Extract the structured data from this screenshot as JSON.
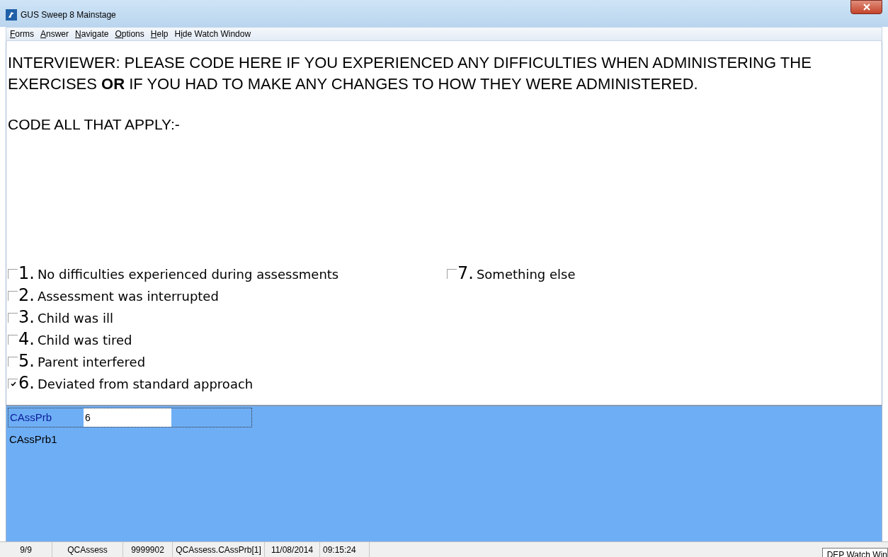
{
  "window": {
    "title": "GUS Sweep 8 Mainstage"
  },
  "menu": [
    {
      "key": "F",
      "rest": "orms"
    },
    {
      "key": "A",
      "rest": "nswer"
    },
    {
      "key": "N",
      "rest": "avigate"
    },
    {
      "key": "O",
      "rest": "ptions"
    },
    {
      "key": "H",
      "rest": "elp"
    },
    {
      "lead": "H",
      "key": "i",
      "rest": "de Watch Window"
    }
  ],
  "question": {
    "text": "INTERVIEWER: PLEASE CODE HERE IF YOU EXPERIENCED ANY DIFFICULTIES WHEN ADMINISTERING THE EXERCISES **OR** IF YOU HAD TO MAKE ANY CHANGES TO HOW THEY WERE ADMINISTERED.",
    "instruction": "CODE ALL THAT APPLY:-"
  },
  "options_left": [
    {
      "number": "1.",
      "label": "No difficulties experienced during assessments",
      "checked": false
    },
    {
      "number": "2.",
      "label": "Assessment was interrupted",
      "checked": false
    },
    {
      "number": "3.",
      "label": "Child was ill",
      "checked": false
    },
    {
      "number": "4.",
      "label": "Child was tired",
      "checked": false
    },
    {
      "number": "5.",
      "label": "Parent interfered",
      "checked": false
    },
    {
      "number": "6.",
      "label": "Deviated from standard approach",
      "checked": true
    }
  ],
  "options_right": [
    {
      "number": "7.",
      "label": "Something else",
      "checked": false
    }
  ],
  "answer_panel": {
    "field_label": "CAssPrb",
    "value": "6",
    "sub_label": "CAssPrb1"
  },
  "status_bar": [
    "9/9",
    "QCAssess",
    "9999902",
    "QCAssess.CAssPrb[1]",
    "11/08/2014",
    "09:15:24"
  ],
  "tooltip": "DEP Watch Win"
}
